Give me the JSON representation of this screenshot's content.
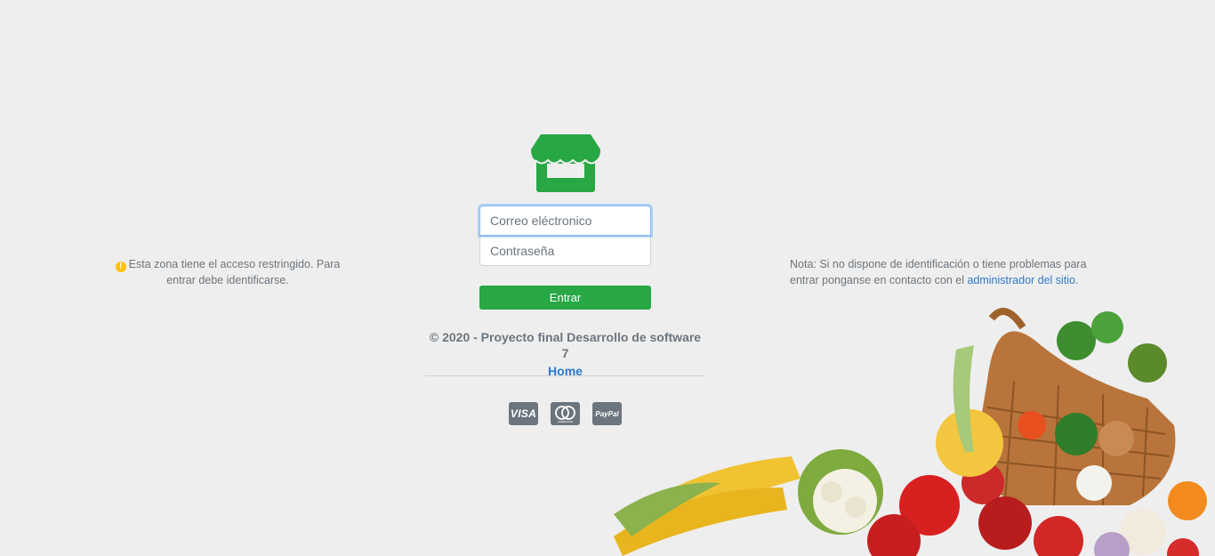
{
  "login": {
    "email_placeholder": "Correo eléctronico",
    "password_placeholder": "Contraseña",
    "submit_label": "Entrar"
  },
  "footer": {
    "copyright": "© 2020 - Proyecto final Desarrollo de software 7",
    "home_link": "Home",
    "payment_cards": [
      "VISA",
      "mastercard",
      "PayPal"
    ]
  },
  "notice_left": {
    "icon": "warning-icon",
    "text": "Esta zona tiene el acceso restringido. Para entrar debe identificarse."
  },
  "notice_right": {
    "text": "Nota: Si no dispone de identificación o tiene problemas para entrar ponganse en contacto con el ",
    "link": "administrador del sitio",
    "suffix": "."
  },
  "colors": {
    "brand_green": "#28a745",
    "link_blue": "#2f79c9",
    "background": "#eeeeee",
    "warning": "#ffc107"
  }
}
